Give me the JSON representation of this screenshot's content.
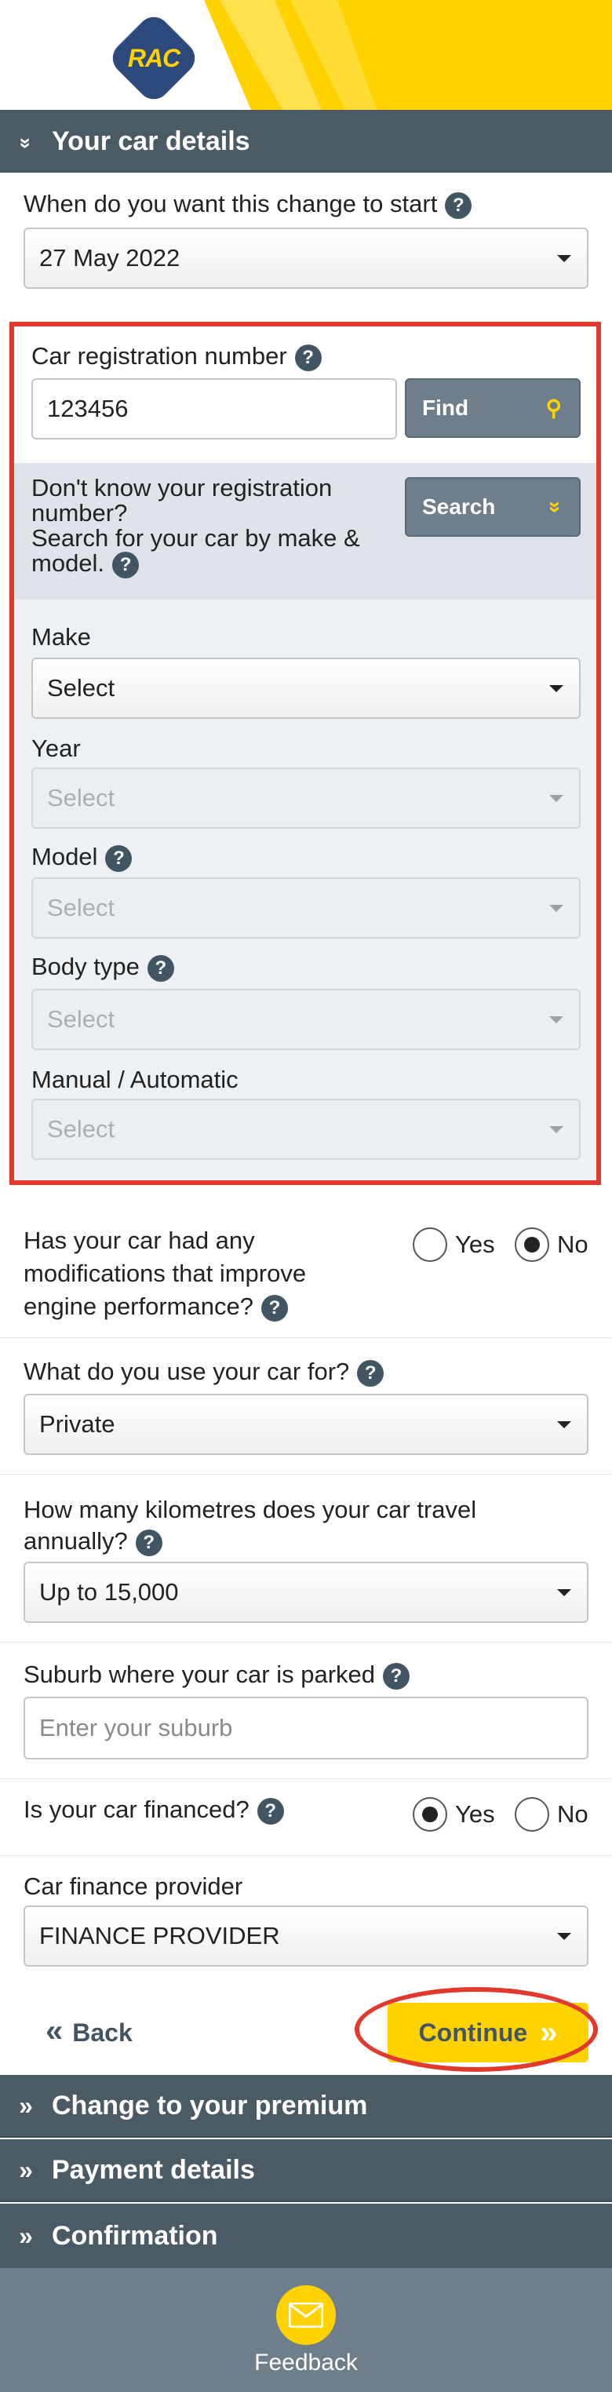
{
  "brand": {
    "logo_text": "RAC",
    "accent": "#ffd200",
    "bar_color": "#4a5b66"
  },
  "sections": {
    "current": "Your car details",
    "next": [
      "Change to your premium",
      "Payment details",
      "Confirmation"
    ]
  },
  "start_date": {
    "label": "When do you want this change to start",
    "value": "27 May 2022"
  },
  "registration": {
    "label": "Car registration number",
    "value": "123456",
    "find_label": "Find",
    "dont_know_line1": "Don't know your registration number?",
    "dont_know_line2": "Search for your car by make & model.",
    "search_label": "Search"
  },
  "make": {
    "label": "Make",
    "value": "Select"
  },
  "year": {
    "label": "Year",
    "value": "Select"
  },
  "model": {
    "label": "Model",
    "value": "Select"
  },
  "body_type": {
    "label": "Body type",
    "value": "Select"
  },
  "transmission": {
    "label": "Manual / Automatic",
    "value": "Select"
  },
  "modifications": {
    "label": "Has your car had any modifications that improve engine performance?",
    "yes": "Yes",
    "no": "No",
    "selected": "No"
  },
  "usage": {
    "label": "What do you use your car for?",
    "value": "Private"
  },
  "kilometres": {
    "label": "How many kilometres does your car travel annually?",
    "value": "Up to 15,000"
  },
  "suburb": {
    "label": "Suburb where your car is parked",
    "placeholder": "Enter your suburb"
  },
  "financed": {
    "label": "Is your car financed?",
    "yes": "Yes",
    "no": "No",
    "selected": "Yes"
  },
  "finance_provider": {
    "label": "Car finance provider",
    "value": "FINANCE PROVIDER"
  },
  "nav": {
    "back": "Back",
    "continue": "Continue"
  },
  "feedback": {
    "label": "Feedback"
  }
}
